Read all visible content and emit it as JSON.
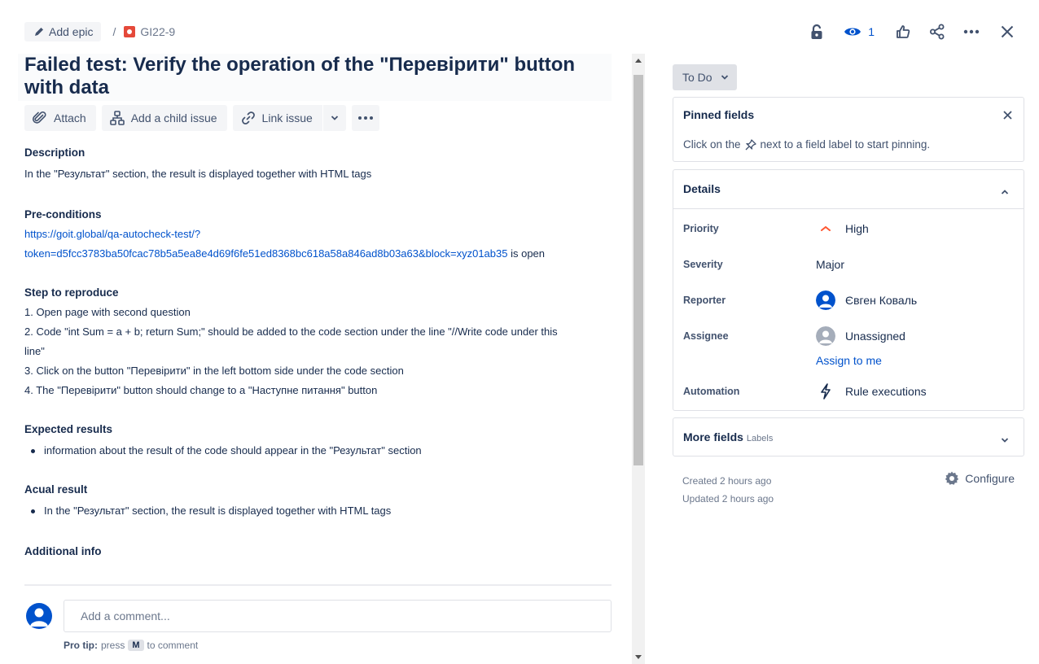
{
  "breadcrumb": {
    "add_epic_label": "Add epic",
    "separator": "/",
    "issue_key": "GI22-9"
  },
  "top_actions": {
    "watch_count": "1"
  },
  "issue": {
    "title": "Failed test: Verify the operation of the \"Перевірити\" button with data"
  },
  "toolbar": {
    "attach_label": "Attach",
    "child_issue_label": "Add a child issue",
    "link_issue_label": "Link issue"
  },
  "description": {
    "heading": "Description",
    "text": "In the \"Результат\" section, the result is displayed together with HTML tags",
    "preconditions_heading": "Pre-conditions",
    "preconditions_link_1": "https://goit.global/qa-autocheck-test/?",
    "preconditions_link_2": "token=d5fcc3783ba50fcac78b5a5ea8e4d69f6fe51ed8368bc618a58a846ad8b03a63&block=xyz01ab35",
    "preconditions_suffix": " is open",
    "steps_heading": "Step to reproduce",
    "steps": [
      "1. Open page with second question",
      "2. Code \"int Sum = a + b; return Sum;\" should be added to the code section under the line \"//Write code under this",
      "line\"",
      "3. Click on the button \"Перевірити\" in the left bottom side under the code section",
      "4. The \"Перевірити\" button should change to a \"Наступне питання\" button"
    ],
    "expected_heading": "Expected results",
    "expected_items": [
      "information about the result of the code should appear in the \"Результат\" section"
    ],
    "actual_heading": "Acual result",
    "actual_items": [
      "In the \"Результат\" section, the result is displayed together with HTML tags"
    ],
    "additional_heading": "Additional info"
  },
  "comment": {
    "placeholder": "Add a comment...",
    "protip_label": "Pro tip:",
    "protip_press": "press",
    "protip_key": "M",
    "protip_suffix": "to comment"
  },
  "status": {
    "label": "To Do"
  },
  "pinned": {
    "heading": "Pinned fields",
    "text_before": "Click on the",
    "text_after": "next to a field label to start pinning."
  },
  "details": {
    "heading": "Details",
    "rows": [
      {
        "label": "Priority",
        "value": "High"
      },
      {
        "label": "Severity",
        "value": "Major"
      },
      {
        "label": "Reporter",
        "value": "Євген Коваль"
      },
      {
        "label": "Assignee",
        "value": "Unassigned"
      },
      {
        "label": "Automation",
        "value": "Rule executions"
      }
    ],
    "assign_to_me": "Assign to me"
  },
  "more_fields": {
    "heading": "More fields",
    "sub": "Labels"
  },
  "meta": {
    "created": "Created 2 hours ago",
    "updated": "Updated 2 hours ago",
    "configure_label": "Configure"
  },
  "colors": {
    "link": "#0052cc",
    "priority_high": "#ff5630",
    "bug": "#e5493a",
    "avatar": "#0052cc"
  }
}
